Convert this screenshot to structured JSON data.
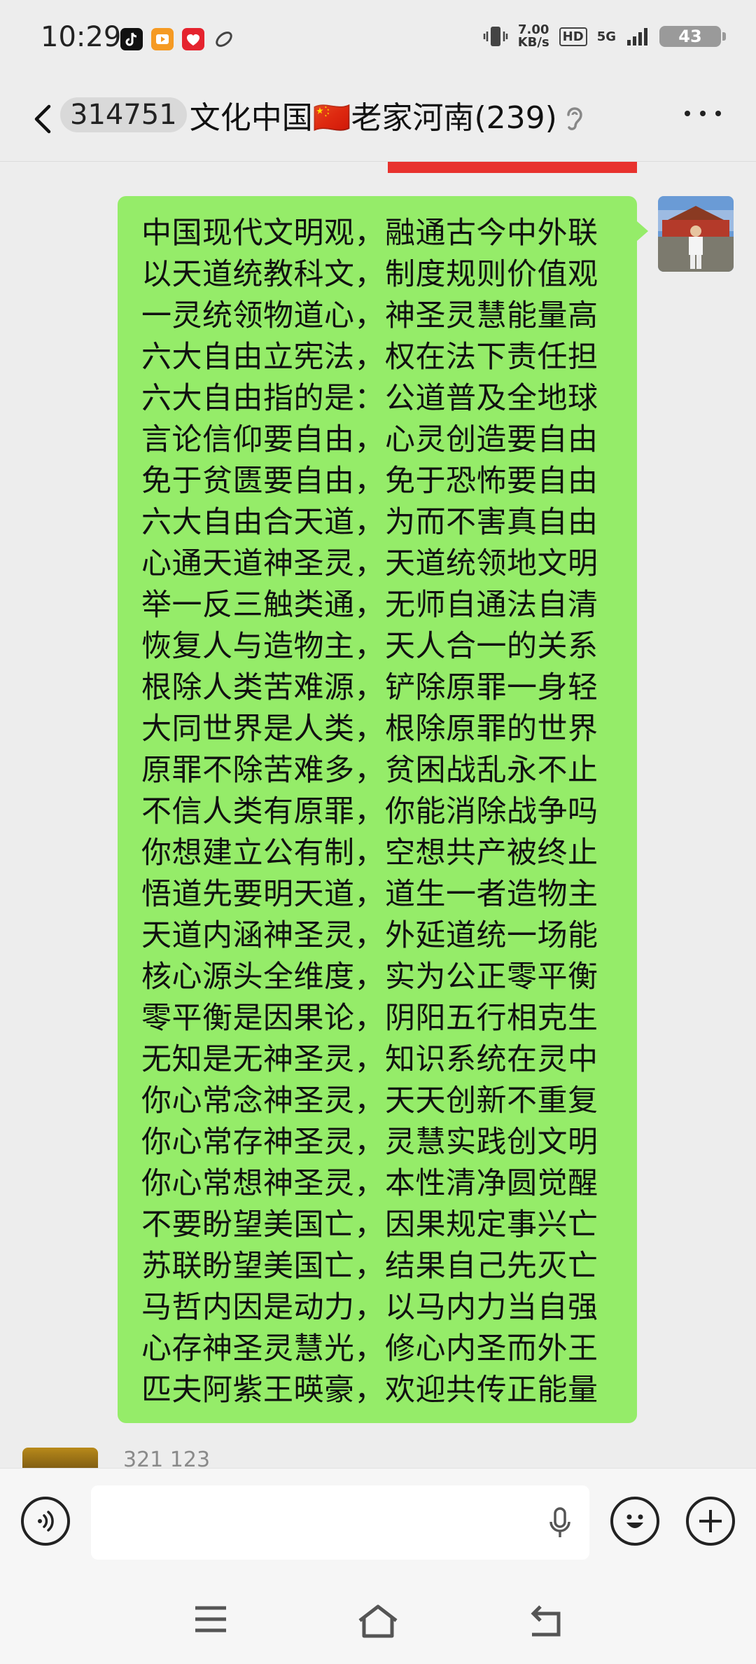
{
  "status_bar": {
    "time": "10:29",
    "net_speed_value": "7.00",
    "net_speed_unit": "KB/s",
    "hd": "HD",
    "signal": "5G",
    "battery": "43"
  },
  "header": {
    "group_id": "314751",
    "title": "文化中国🇨🇳老家河南(239)"
  },
  "message": {
    "lines": [
      "中国现代文明观，融通古今中外联",
      "以天道统教科文，制度规则价值观",
      "一灵统领物道心，神圣灵慧能量高",
      "六大自由立宪法，权在法下责任担",
      "六大自由指的是：公道普及全地球",
      "言论信仰要自由，心灵创造要自由",
      "免于贫匮要自由，免于恐怖要自由",
      "六大自由合天道，为而不害真自由",
      "心通天道神圣灵，天道统领地文明",
      "举一反三触类通，无师自通法自清",
      "恢复人与造物主，天人合一的关系",
      "根除人类苦难源，铲除原罪一身轻",
      "大同世界是人类，根除原罪的世界",
      "原罪不除苦难多，贫困战乱永不止",
      "不信人类有原罪，你能消除战争吗",
      "你想建立公有制，空想共产被终止",
      "悟道先要明天道，道生一者造物主",
      "天道内涵神圣灵，外延道统一场能",
      "核心源头全维度，实为公正零平衡",
      "零平衡是因果论，阴阳五行相克生",
      "无知是无神圣灵，知识系统在灵中",
      "你心常念神圣灵，天天创新不重复",
      "你心常存神圣灵，灵慧实践创文明",
      "你心常想神圣灵，本性清净圆觉醒",
      "不要盼望美国亡，因果规定事兴亡",
      "苏联盼望美国亡，结果自己先灭亡",
      "马哲内因是动力，以马内力当自强",
      "心存神圣灵慧光，修心内圣而外王",
      "匹夫阿紫王暎豪，欢迎共传正能量"
    ]
  },
  "next_message": {
    "sender": "321 123"
  },
  "colors": {
    "bubble": "#95ec69",
    "background": "#ededed",
    "banner_red": "#e8322e"
  },
  "icons": [
    "back-icon",
    "ear-icon",
    "more-icon",
    "voice-icon",
    "mic-icon",
    "emoji-icon",
    "plus-icon",
    "menu-icon",
    "home-icon",
    "return-icon"
  ]
}
